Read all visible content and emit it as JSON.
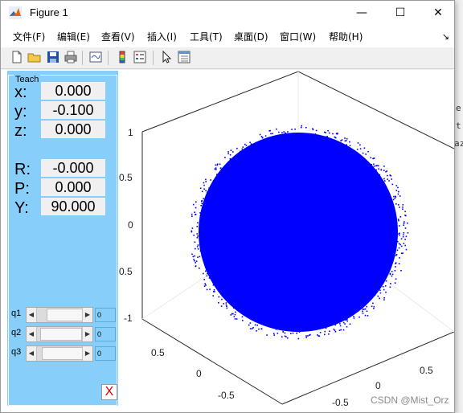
{
  "window": {
    "title": "Figure 1",
    "minimize": "—",
    "maximize": "☐",
    "close": "✕"
  },
  "menu": {
    "items": [
      "文件(F)",
      "编辑(E)",
      "查看(V)",
      "插入(I)",
      "工具(T)",
      "桌面(D)",
      "窗口(W)",
      "帮助(H)"
    ],
    "overflow_arrow": "↘"
  },
  "toolbar": {
    "icons": [
      "new-figure-icon",
      "open-icon",
      "save-icon",
      "print-icon",
      "link-plot-icon",
      "colorbar-icon",
      "legend-icon",
      "pointer-icon",
      "property-editor-icon"
    ]
  },
  "teach": {
    "title": "Teach",
    "pos_labels": [
      "x:",
      "y:",
      "z:"
    ],
    "pos_values": [
      "0.000",
      "-0.100",
      "0.000"
    ],
    "rot_labels": [
      "R:",
      "P:",
      "Y:"
    ],
    "rot_values": [
      "-0.000",
      "0.000",
      "90.000"
    ],
    "joints": [
      {
        "label": "q1",
        "value": "0",
        "level": 0.55
      },
      {
        "label": "q2",
        "value": "0",
        "level": 0.2
      },
      {
        "label": "q3",
        "value": "0",
        "level": 0.3
      }
    ],
    "close_label": "X"
  },
  "plot": {
    "z_ticks": [
      "1",
      "0.5",
      "0",
      "0.5",
      "-1"
    ],
    "x_ticks": [
      "0.5",
      "0",
      "-0.5"
    ],
    "y_ticks": [
      "0",
      "0.5",
      "-0.5"
    ],
    "point_color": "#0000ff"
  },
  "background_fragments": [
    "e",
    "t",
    "az",
    "+t"
  ],
  "watermark": "CSDN @Mist_Orz"
}
